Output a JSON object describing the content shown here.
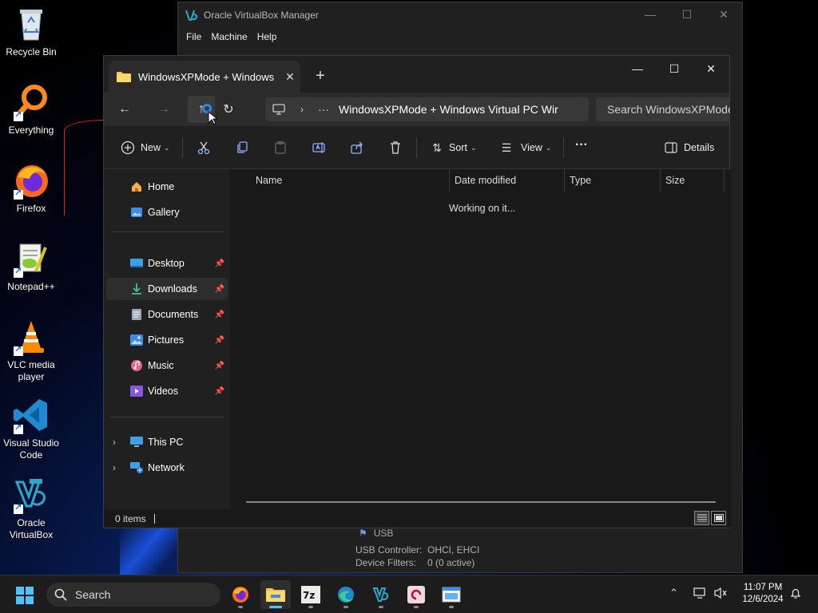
{
  "desktop": {
    "icons": [
      {
        "label": "Recycle Bin",
        "icon": "recycle-bin-icon"
      },
      {
        "label": "Everything",
        "icon": "everything-search-icon"
      },
      {
        "label": "Firefox",
        "icon": "firefox-icon"
      },
      {
        "label": "Notepad++",
        "icon": "notepad-plus-plus-icon"
      },
      {
        "label": "VLC media player",
        "icon": "vlc-cone-icon"
      },
      {
        "label": "Visual Studio Code",
        "icon": "vscode-icon"
      },
      {
        "label": "Oracle VirtualBox",
        "icon": "virtualbox-icon"
      }
    ]
  },
  "vbox": {
    "title": "Oracle VirtualBox Manager",
    "menu": [
      "File",
      "Machine",
      "Help"
    ],
    "usb": {
      "section": "USB",
      "controller_label": "USB Controller:",
      "controller_value": "OHCI, EHCI",
      "filters_label": "Device Filters:",
      "filters_value": "0 (0 active)"
    }
  },
  "explorer": {
    "tab_title": "WindowsXPMode + Windows",
    "address_path": "WindowsXPMode + Windows Virtual PC Wir",
    "search_placeholder": "Search WindowsXPMode",
    "commands": {
      "new": "New",
      "sort": "Sort",
      "view": "View",
      "more": "···",
      "details": "Details"
    },
    "nav": {
      "home": "Home",
      "gallery": "Gallery",
      "desktop": "Desktop",
      "downloads": "Downloads",
      "documents": "Documents",
      "pictures": "Pictures",
      "music": "Music",
      "videos": "Videos",
      "this_pc": "This PC",
      "network": "Network"
    },
    "columns": {
      "name": "Name",
      "date": "Date modified",
      "type": "Type",
      "size": "Size"
    },
    "status_message": "Working on it...",
    "status_bar": "0 items"
  },
  "taskbar": {
    "search_label": "Search",
    "apps": [
      "firefox-icon",
      "file-explorer-icon",
      "7zip-icon",
      "edge-icon",
      "virtualbox-icon",
      "debian-icon",
      "remote-window-icon"
    ],
    "time": "11:07 PM",
    "date": "12/6/2024"
  },
  "colors": {
    "accent": "#4cc2ff",
    "explorer_bg": "#191919",
    "toolbar_bg": "#202020"
  }
}
